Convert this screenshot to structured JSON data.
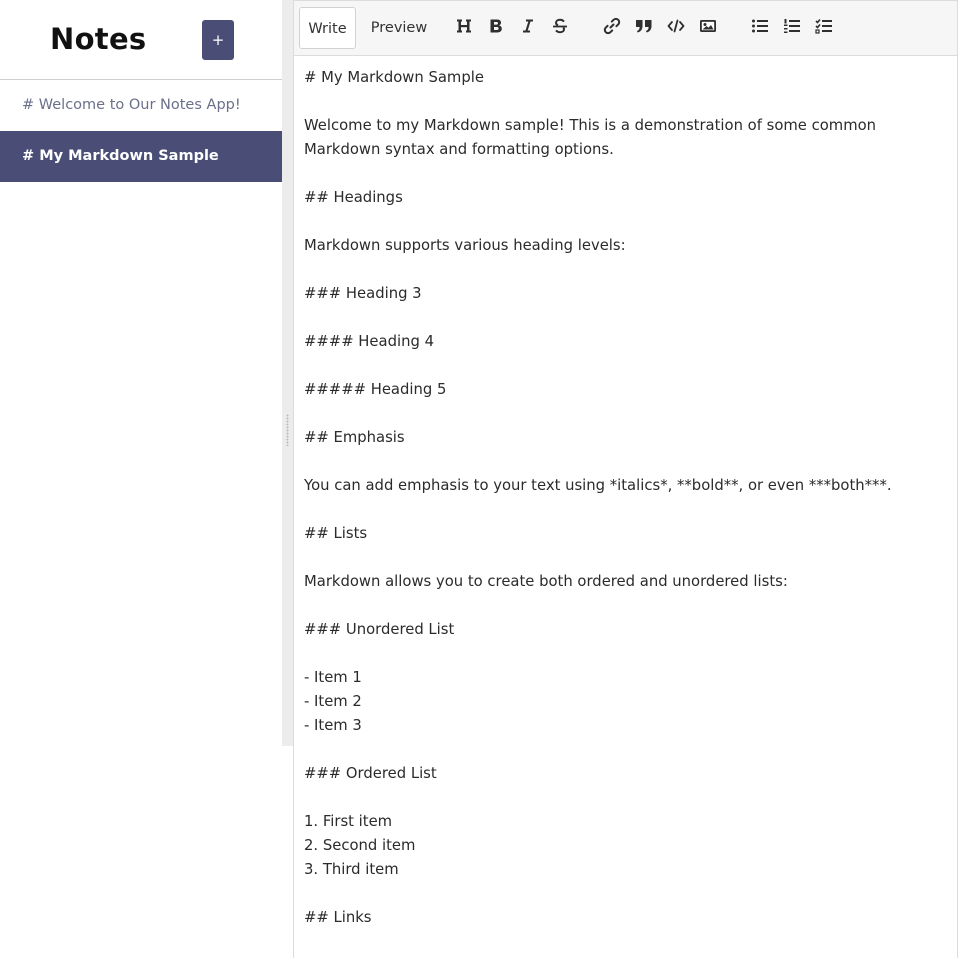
{
  "sidebar": {
    "title": "Notes",
    "add_button_label": "+",
    "notes": [
      {
        "label": "# Welcome to Our Notes App!",
        "active": false
      },
      {
        "label": "# My Markdown Sample",
        "active": true
      }
    ]
  },
  "editor": {
    "tabs": {
      "write": "Write",
      "preview": "Preview"
    },
    "active_tab": "Write",
    "toolbar_icons": [
      "header-icon",
      "bold-icon",
      "italic-icon",
      "strikethrough-icon",
      "link-icon",
      "quote-icon",
      "code-icon",
      "image-icon",
      "unordered-list-icon",
      "ordered-list-icon",
      "checked-list-icon"
    ],
    "lines": [
      "# My Markdown Sample",
      "",
      "Welcome to my Markdown sample! This is a demonstration of some common Markdown syntax and formatting options.",
      "",
      "## Headings",
      "",
      "Markdown supports various heading levels:",
      "",
      "### Heading 3",
      "",
      "#### Heading 4",
      "",
      "##### Heading 5",
      "",
      "## Emphasis",
      "",
      "You can add emphasis to your text using *italics*, **bold**, or even ***both***.",
      "",
      "## Lists",
      "",
      "Markdown allows you to create both ordered and unordered lists:",
      "",
      "### Unordered List",
      "",
      "- Item 1",
      "- Item 2",
      "- Item 3",
      "",
      "### Ordered List",
      "",
      "1. First item",
      "2. Second item",
      "3. Third item",
      "",
      "## Links"
    ]
  },
  "colors": {
    "accent": "#4a4e77",
    "toolbar_bg": "#f6f6f6",
    "splitter": "#ececec"
  }
}
